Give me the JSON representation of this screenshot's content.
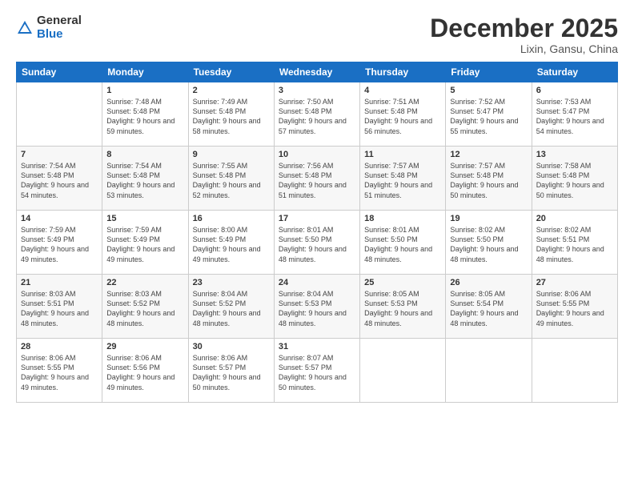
{
  "logo": {
    "general": "General",
    "blue": "Blue"
  },
  "title": "December 2025",
  "location": "Lixin, Gansu, China",
  "days_of_week": [
    "Sunday",
    "Monday",
    "Tuesday",
    "Wednesday",
    "Thursday",
    "Friday",
    "Saturday"
  ],
  "weeks": [
    [
      {
        "day": "",
        "sunrise": "",
        "sunset": "",
        "daylight": ""
      },
      {
        "day": "1",
        "sunrise": "Sunrise: 7:48 AM",
        "sunset": "Sunset: 5:48 PM",
        "daylight": "Daylight: 9 hours and 59 minutes."
      },
      {
        "day": "2",
        "sunrise": "Sunrise: 7:49 AM",
        "sunset": "Sunset: 5:48 PM",
        "daylight": "Daylight: 9 hours and 58 minutes."
      },
      {
        "day": "3",
        "sunrise": "Sunrise: 7:50 AM",
        "sunset": "Sunset: 5:48 PM",
        "daylight": "Daylight: 9 hours and 57 minutes."
      },
      {
        "day": "4",
        "sunrise": "Sunrise: 7:51 AM",
        "sunset": "Sunset: 5:48 PM",
        "daylight": "Daylight: 9 hours and 56 minutes."
      },
      {
        "day": "5",
        "sunrise": "Sunrise: 7:52 AM",
        "sunset": "Sunset: 5:47 PM",
        "daylight": "Daylight: 9 hours and 55 minutes."
      },
      {
        "day": "6",
        "sunrise": "Sunrise: 7:53 AM",
        "sunset": "Sunset: 5:47 PM",
        "daylight": "Daylight: 9 hours and 54 minutes."
      }
    ],
    [
      {
        "day": "7",
        "sunrise": "Sunrise: 7:54 AM",
        "sunset": "Sunset: 5:48 PM",
        "daylight": "Daylight: 9 hours and 54 minutes."
      },
      {
        "day": "8",
        "sunrise": "Sunrise: 7:54 AM",
        "sunset": "Sunset: 5:48 PM",
        "daylight": "Daylight: 9 hours and 53 minutes."
      },
      {
        "day": "9",
        "sunrise": "Sunrise: 7:55 AM",
        "sunset": "Sunset: 5:48 PM",
        "daylight": "Daylight: 9 hours and 52 minutes."
      },
      {
        "day": "10",
        "sunrise": "Sunrise: 7:56 AM",
        "sunset": "Sunset: 5:48 PM",
        "daylight": "Daylight: 9 hours and 51 minutes."
      },
      {
        "day": "11",
        "sunrise": "Sunrise: 7:57 AM",
        "sunset": "Sunset: 5:48 PM",
        "daylight": "Daylight: 9 hours and 51 minutes."
      },
      {
        "day": "12",
        "sunrise": "Sunrise: 7:57 AM",
        "sunset": "Sunset: 5:48 PM",
        "daylight": "Daylight: 9 hours and 50 minutes."
      },
      {
        "day": "13",
        "sunrise": "Sunrise: 7:58 AM",
        "sunset": "Sunset: 5:48 PM",
        "daylight": "Daylight: 9 hours and 50 minutes."
      }
    ],
    [
      {
        "day": "14",
        "sunrise": "Sunrise: 7:59 AM",
        "sunset": "Sunset: 5:49 PM",
        "daylight": "Daylight: 9 hours and 49 minutes."
      },
      {
        "day": "15",
        "sunrise": "Sunrise: 7:59 AM",
        "sunset": "Sunset: 5:49 PM",
        "daylight": "Daylight: 9 hours and 49 minutes."
      },
      {
        "day": "16",
        "sunrise": "Sunrise: 8:00 AM",
        "sunset": "Sunset: 5:49 PM",
        "daylight": "Daylight: 9 hours and 49 minutes."
      },
      {
        "day": "17",
        "sunrise": "Sunrise: 8:01 AM",
        "sunset": "Sunset: 5:50 PM",
        "daylight": "Daylight: 9 hours and 48 minutes."
      },
      {
        "day": "18",
        "sunrise": "Sunrise: 8:01 AM",
        "sunset": "Sunset: 5:50 PM",
        "daylight": "Daylight: 9 hours and 48 minutes."
      },
      {
        "day": "19",
        "sunrise": "Sunrise: 8:02 AM",
        "sunset": "Sunset: 5:50 PM",
        "daylight": "Daylight: 9 hours and 48 minutes."
      },
      {
        "day": "20",
        "sunrise": "Sunrise: 8:02 AM",
        "sunset": "Sunset: 5:51 PM",
        "daylight": "Daylight: 9 hours and 48 minutes."
      }
    ],
    [
      {
        "day": "21",
        "sunrise": "Sunrise: 8:03 AM",
        "sunset": "Sunset: 5:51 PM",
        "daylight": "Daylight: 9 hours and 48 minutes."
      },
      {
        "day": "22",
        "sunrise": "Sunrise: 8:03 AM",
        "sunset": "Sunset: 5:52 PM",
        "daylight": "Daylight: 9 hours and 48 minutes."
      },
      {
        "day": "23",
        "sunrise": "Sunrise: 8:04 AM",
        "sunset": "Sunset: 5:52 PM",
        "daylight": "Daylight: 9 hours and 48 minutes."
      },
      {
        "day": "24",
        "sunrise": "Sunrise: 8:04 AM",
        "sunset": "Sunset: 5:53 PM",
        "daylight": "Daylight: 9 hours and 48 minutes."
      },
      {
        "day": "25",
        "sunrise": "Sunrise: 8:05 AM",
        "sunset": "Sunset: 5:53 PM",
        "daylight": "Daylight: 9 hours and 48 minutes."
      },
      {
        "day": "26",
        "sunrise": "Sunrise: 8:05 AM",
        "sunset": "Sunset: 5:54 PM",
        "daylight": "Daylight: 9 hours and 48 minutes."
      },
      {
        "day": "27",
        "sunrise": "Sunrise: 8:06 AM",
        "sunset": "Sunset: 5:55 PM",
        "daylight": "Daylight: 9 hours and 49 minutes."
      }
    ],
    [
      {
        "day": "28",
        "sunrise": "Sunrise: 8:06 AM",
        "sunset": "Sunset: 5:55 PM",
        "daylight": "Daylight: 9 hours and 49 minutes."
      },
      {
        "day": "29",
        "sunrise": "Sunrise: 8:06 AM",
        "sunset": "Sunset: 5:56 PM",
        "daylight": "Daylight: 9 hours and 49 minutes."
      },
      {
        "day": "30",
        "sunrise": "Sunrise: 8:06 AM",
        "sunset": "Sunset: 5:57 PM",
        "daylight": "Daylight: 9 hours and 50 minutes."
      },
      {
        "day": "31",
        "sunrise": "Sunrise: 8:07 AM",
        "sunset": "Sunset: 5:57 PM",
        "daylight": "Daylight: 9 hours and 50 minutes."
      },
      {
        "day": "",
        "sunrise": "",
        "sunset": "",
        "daylight": ""
      },
      {
        "day": "",
        "sunrise": "",
        "sunset": "",
        "daylight": ""
      },
      {
        "day": "",
        "sunrise": "",
        "sunset": "",
        "daylight": ""
      }
    ]
  ]
}
